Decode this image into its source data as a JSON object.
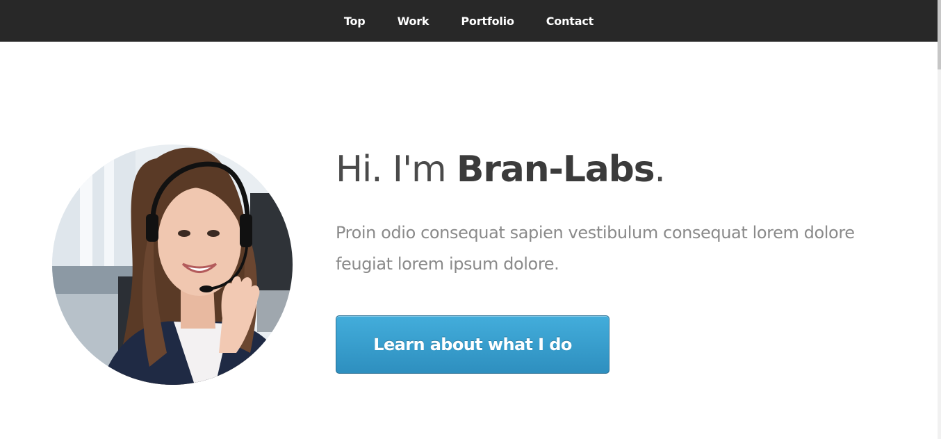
{
  "nav": {
    "items": [
      {
        "label": "Top"
      },
      {
        "label": "Work"
      },
      {
        "label": "Portfolio"
      },
      {
        "label": "Contact"
      }
    ]
  },
  "hero": {
    "greeting": "Hi. I'm",
    "name": "Bran-Labs",
    "period": ".",
    "description": "Proin odio consequat sapien vestibulum consequat lorem dolore feugiat lorem ipsum dolore.",
    "cta_label": "Learn about what I do"
  },
  "colors": {
    "nav_bg": "#282828",
    "button_top": "#43addb",
    "button_bottom": "#2e8fbf",
    "headline": "#3a3a3a",
    "body_text": "#8a8a8a"
  }
}
